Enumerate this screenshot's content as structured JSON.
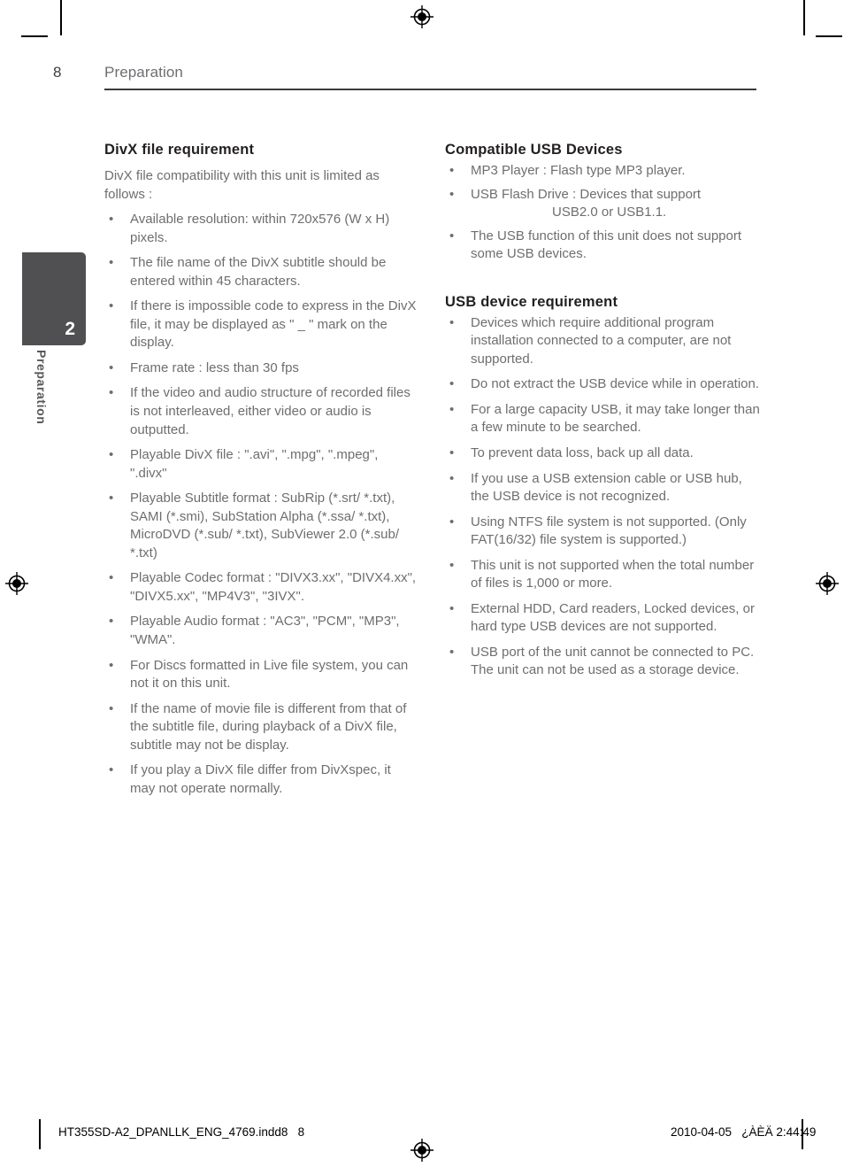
{
  "header": {
    "page_number": "8",
    "chapter_name": "Preparation"
  },
  "side_tab": {
    "number": "2",
    "label": "Preparation"
  },
  "left_column": {
    "section_title": "DivX file requirement",
    "intro": "DivX file compatibility with this unit is limited as follows :",
    "bullets": [
      "Available resolution: within 720x576 (W x H) pixels.",
      "The file name of the DivX subtitle should be entered within 45 characters.",
      "If there is impossible code to express in the DivX file, it may be displayed as \" _ \" mark on the display.",
      "Frame rate : less than 30 fps",
      "If the video and audio structure of recorded files is not interleaved, either video or audio is outputted.",
      "Playable DivX file : \".avi\", \".mpg\", \".mpeg\", \".divx\"",
      "Playable Subtitle format : SubRip (*.srt/ *.txt), SAMI (*.smi), SubStation Alpha (*.ssa/ *.txt), MicroDVD (*.sub/ *.txt), SubViewer 2.0 (*.sub/ *.txt)",
      "Playable Codec format : \"DIVX3.xx\", \"DIVX4.xx\", \"DIVX5.xx\", \"MP4V3\", \"3IVX\".",
      "Playable Audio format : \"AC3\", \"PCM\", \"MP3\", \"WMA\".",
      "For Discs formatted in Live file system, you can not it  on this unit.",
      "If the name of movie file is different from that of the subtitle file, during playback of a DivX file, subtitle may not be display.",
      "If you play a DivX file differ from DivXspec, it may not operate normally."
    ]
  },
  "right_column": {
    "section1_title": "Compatible USB Devices",
    "section1_bullets": [
      "MP3 Player : Flash type MP3 player.",
      "USB Flash Drive : Devices that support",
      "The USB function of this unit does not support some USB devices."
    ],
    "section1_bullet2_indented": "USB2.0 or USB1.1.",
    "section2_title": "USB device requirement",
    "section2_bullets": [
      "Devices which require additional program installation connected to a computer, are not supported.",
      "Do not extract the USB device while in operation.",
      "For a large capacity USB, it may take longer than a few minute to be searched.",
      "To prevent data loss, back up all data.",
      "If you use a USB extension cable or USB hub, the USB device is not recognized.",
      "Using NTFS file system is not supported. (Only FAT(16/32) file system is supported.)",
      "This unit is not supported when the total number of files is 1,000 or more.",
      "External HDD, Card readers, Locked devices, or hard type USB devices are not supported.",
      "USB port of the unit cannot be connected to PC. The unit can not be used as a storage device."
    ]
  },
  "footer": {
    "file_name": "HT355SD-A2_DPANLLK_ENG_4769.indd8   8",
    "timestamp": "2010-04-05   ¿ÀÈÄ 2:44:49"
  },
  "bullet_glyph": "•",
  "colors": {
    "tab_background": "#505052",
    "heading_text": "#231f20",
    "body_text": "#6d6e71",
    "rule": "#3b3b3d"
  }
}
